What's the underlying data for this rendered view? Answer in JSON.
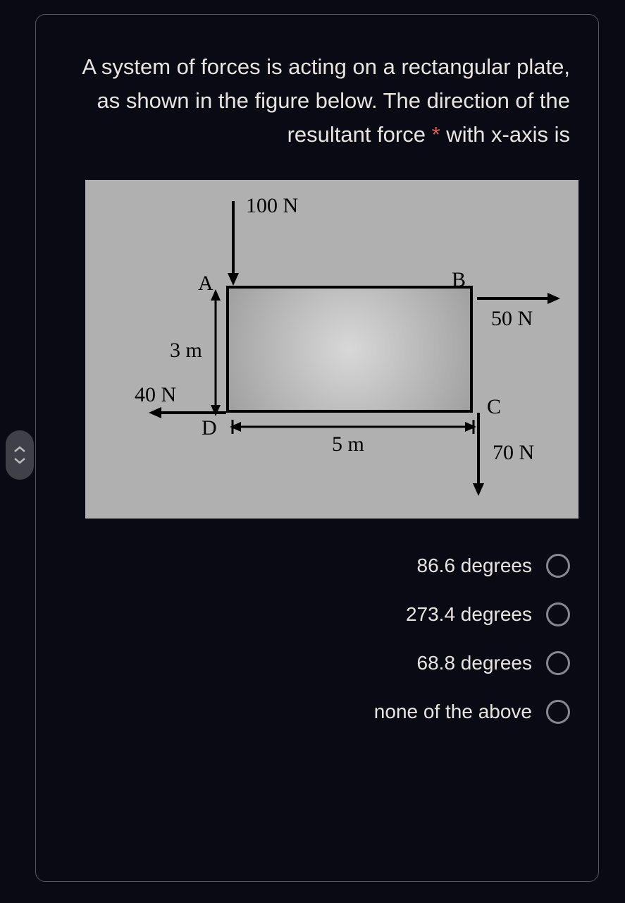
{
  "question": {
    "text_prefix": "A system of forces is acting on a rectangular plate, as shown in the figure below. The direction of the resultant force with x-axis is",
    "required_marker": "*"
  },
  "figure": {
    "forces": {
      "top": "100 N",
      "right": "50 N",
      "left": "40 N",
      "bottom": "70 N"
    },
    "corners": {
      "A": "A",
      "B": "B",
      "C": "C",
      "D": "D"
    },
    "dimensions": {
      "height": "3 m",
      "width": "5 m"
    }
  },
  "options": [
    {
      "label": "86.6 degrees"
    },
    {
      "label": "273.4 degrees"
    },
    {
      "label": "68.8 degrees"
    },
    {
      "label": "none of the above"
    }
  ],
  "chart_data": {
    "type": "diagram",
    "shape": "rectangle",
    "width_m": 5,
    "height_m": 3,
    "forces": [
      {
        "at": "A",
        "magnitude_N": 100,
        "direction": "down"
      },
      {
        "at": "B",
        "magnitude_N": 50,
        "direction": "right"
      },
      {
        "at": "D",
        "magnitude_N": 40,
        "direction": "left"
      },
      {
        "at": "C",
        "magnitude_N": 70,
        "direction": "down"
      }
    ]
  }
}
